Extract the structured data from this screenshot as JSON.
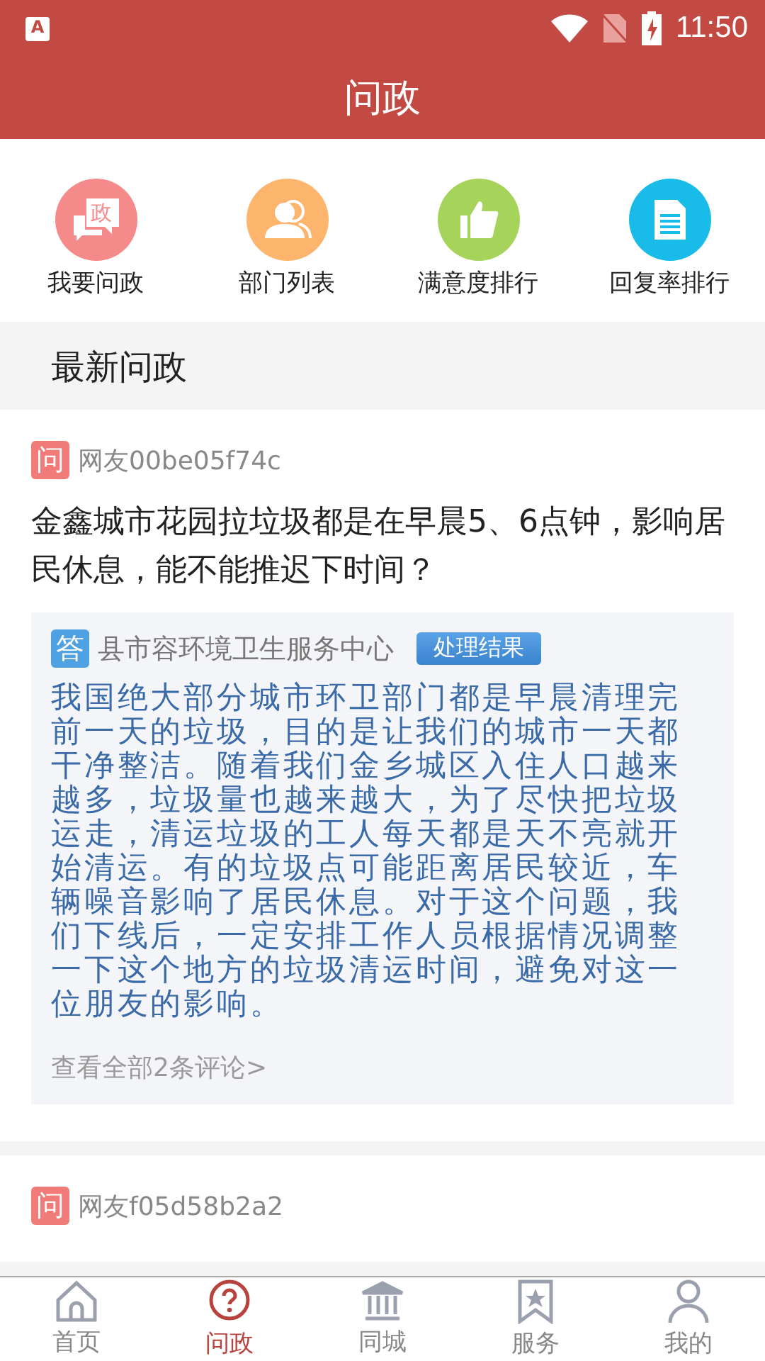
{
  "status_bar": {
    "app_badge": "A",
    "time": "11:50"
  },
  "header": {
    "title": "问政"
  },
  "shortcuts": [
    {
      "label": "我要问政",
      "icon_text": "政",
      "color": "#f58a8a"
    },
    {
      "label": "部门列表",
      "color": "#fdb56e"
    },
    {
      "label": "满意度排行",
      "color": "#a6d35a"
    },
    {
      "label": "回复率排行",
      "color": "#19bce8"
    }
  ],
  "section_title": "最新问政",
  "posts": [
    {
      "badge": "问",
      "user": "网友00be05f74c",
      "question": "金鑫城市花园拉垃圾都是在早晨5、6点钟，影响居民休息，能不能推迟下时间？",
      "answer": {
        "badge": "答",
        "department": "县市容环境卫生服务中心",
        "tag": "处理结果",
        "text": "我国绝大部分城市环卫部门都是早晨清理完前一天的垃圾，目的是让我们的城市一天都干净整洁。随着我们金乡城区入住人口越来越多，垃圾量也越来越大，为了尽快把垃圾运走，清运垃圾的工人每天都是天不亮就开始清运。有的垃圾点可能距离居民较近，车辆噪音影响了居民休息。对于这个问题，我们下线后，一定安排工作人员根据情况调整一下这个地方的垃圾清运时间，避免对这一位朋友的影响。",
        "more": "查看全部2条评论>"
      }
    },
    {
      "badge": "问",
      "user": "网友f05d58b2a2"
    }
  ],
  "bottom_nav": [
    {
      "label": "首页",
      "selected": false
    },
    {
      "label": "问政",
      "selected": true
    },
    {
      "label": "同城",
      "selected": false
    },
    {
      "label": "服务",
      "selected": false
    },
    {
      "label": "我的",
      "selected": false
    }
  ]
}
